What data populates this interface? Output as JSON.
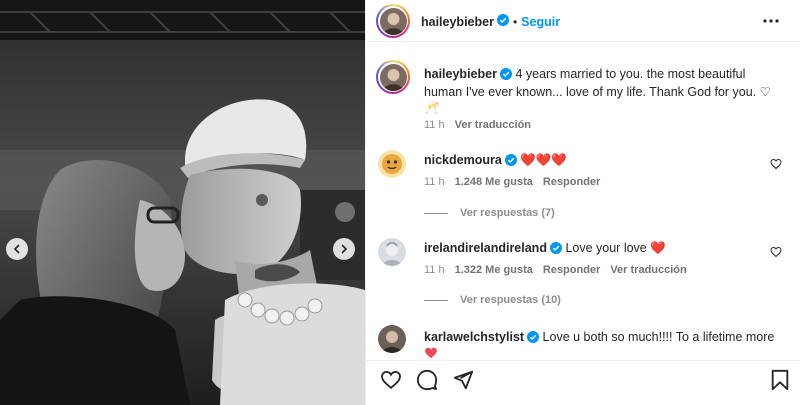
{
  "post": {
    "author": "haileybieber",
    "follow_label": "Seguir",
    "separator": "•",
    "caption_text": "4 years married to you. the most beautiful human I've ever known... love of my life. Thank God for you. ♡ 🥂",
    "caption_time": "11 h",
    "caption_translate": "Ver traducción"
  },
  "comments": [
    {
      "user": "nickdemoura",
      "text": "❤️❤️❤️",
      "time": "11 h",
      "likes": "1.248 Me gusta",
      "reply": "Responder",
      "view_replies": "Ver respuestas (7)"
    },
    {
      "user": "irelandirelandireland",
      "text": "Love your love ❤️",
      "time": "11 h",
      "likes": "1.322 Me gusta",
      "reply": "Responder",
      "translate": "Ver traducción",
      "view_replies": "Ver respuestas (10)"
    },
    {
      "user": "karlawelchstylist",
      "text": "Love u both so much!!!! To a lifetime more"
    }
  ],
  "icons": {
    "verified": "verified-badge-icon",
    "more": "more-options-icon",
    "like": "heart-icon",
    "comment": "comment-icon",
    "share": "share-icon",
    "save": "bookmark-icon",
    "prev": "chevron-left-icon",
    "next": "chevron-right-icon"
  },
  "colors": {
    "accent": "#0095f6",
    "verified": "#0095f6",
    "heart": "#ed4956",
    "muted": "#8e8e8e"
  }
}
